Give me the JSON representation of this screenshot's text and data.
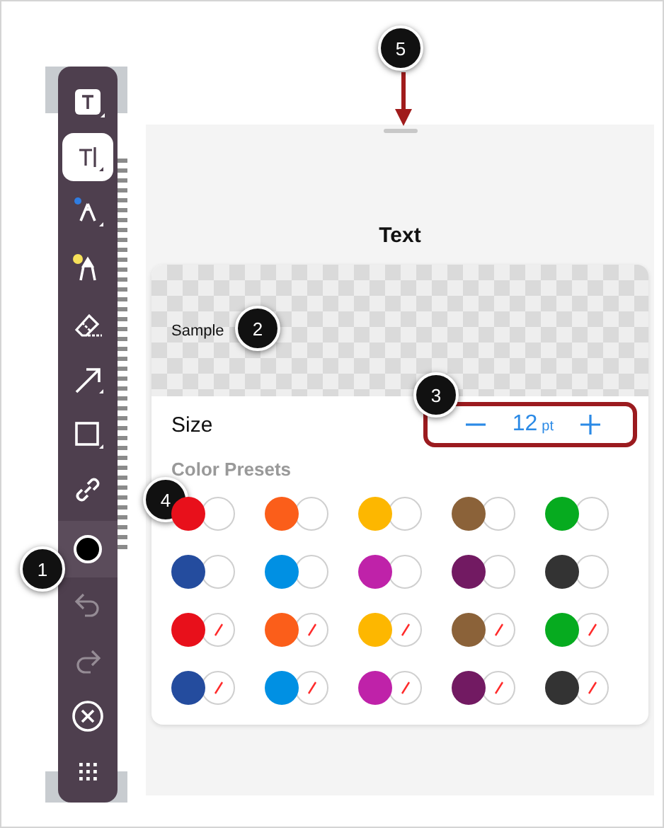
{
  "toolbar": {
    "tools": [
      {
        "kind": "text-box",
        "selected": false,
        "disabled": false
      },
      {
        "kind": "text",
        "selected": true,
        "disabled": false
      },
      {
        "kind": "pen",
        "selected": false,
        "disabled": false,
        "color": "#2f7de1"
      },
      {
        "kind": "highlighter",
        "selected": false,
        "disabled": false,
        "color": "#f7e15a"
      },
      {
        "kind": "eraser",
        "selected": false,
        "disabled": false
      },
      {
        "kind": "arrow",
        "selected": false,
        "disabled": false
      },
      {
        "kind": "square",
        "selected": false,
        "disabled": false
      },
      {
        "kind": "link",
        "selected": false,
        "disabled": false
      },
      {
        "kind": "color",
        "selected": false,
        "disabled": false,
        "color": "#000000"
      },
      {
        "kind": "undo",
        "selected": false,
        "disabled": true
      },
      {
        "kind": "redo",
        "selected": false,
        "disabled": true
      },
      {
        "kind": "close",
        "selected": false,
        "disabled": false
      },
      {
        "kind": "more",
        "selected": false,
        "disabled": false
      }
    ]
  },
  "panel": {
    "title": "Text",
    "sample": "Sample",
    "size": {
      "label": "Size",
      "value": "12",
      "unit": "pt"
    },
    "color_presets": {
      "label": "Color Presets",
      "swatches": [
        {
          "color": "#e8101b",
          "kind": "white-fill"
        },
        {
          "color": "#fb5e1a",
          "kind": "white-fill"
        },
        {
          "color": "#fdb700",
          "kind": "white-fill"
        },
        {
          "color": "#8b6239",
          "kind": "white-fill"
        },
        {
          "color": "#06ab1f",
          "kind": "white-fill"
        },
        {
          "color": "#244c9e",
          "kind": "white-fill"
        },
        {
          "color": "#0090e3",
          "kind": "white-fill"
        },
        {
          "color": "#bf22a9",
          "kind": "white-fill"
        },
        {
          "color": "#721a62",
          "kind": "white-fill"
        },
        {
          "color": "#333333",
          "kind": "white-fill"
        },
        {
          "color": "#e8101b",
          "kind": "no-fill"
        },
        {
          "color": "#fb5e1a",
          "kind": "no-fill"
        },
        {
          "color": "#fdb700",
          "kind": "no-fill"
        },
        {
          "color": "#8b6239",
          "kind": "no-fill"
        },
        {
          "color": "#06ab1f",
          "kind": "no-fill"
        },
        {
          "color": "#244c9e",
          "kind": "no-fill"
        },
        {
          "color": "#0090e3",
          "kind": "no-fill"
        },
        {
          "color": "#bf22a9",
          "kind": "no-fill"
        },
        {
          "color": "#721a62",
          "kind": "no-fill"
        },
        {
          "color": "#333333",
          "kind": "no-fill"
        }
      ]
    }
  },
  "callouts": [
    "1",
    "2",
    "3",
    "4",
    "5"
  ]
}
